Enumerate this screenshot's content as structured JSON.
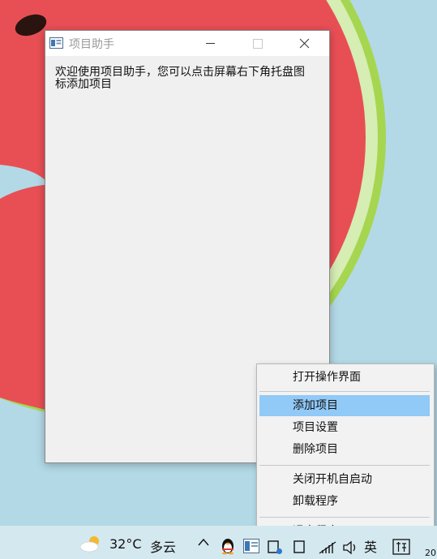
{
  "window": {
    "title": "项目助手",
    "welcome_text": "欢迎使用项目助手，您可以点击屏幕右下角托盘图标添加项目"
  },
  "context_menu": {
    "items": [
      {
        "label": "打开操作界面"
      },
      {
        "label": "添加项目",
        "highlighted": true
      },
      {
        "label": "项目设置"
      },
      {
        "label": "删除项目"
      },
      {
        "label": "关闭开机自启动"
      },
      {
        "label": "卸载程序"
      },
      {
        "label": "退出程序"
      }
    ]
  },
  "taskbar": {
    "weather_icon": "partly-cloudy-icon",
    "temperature": "32°C",
    "condition": "多云",
    "language": "英",
    "clock_partial": "20"
  },
  "colors": {
    "menu_highlight": "#91c9f7",
    "window_bg": "#f0f0f0",
    "wallpaper_bg": "#b3d9e6",
    "watermelon_flesh": "#e84f55",
    "rind_green": "#9ed44a"
  }
}
